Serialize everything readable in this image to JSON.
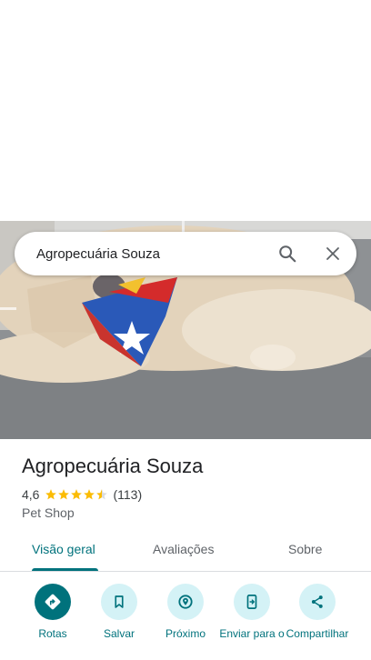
{
  "search": {
    "query": "Agropecuária Souza"
  },
  "place": {
    "name": "Agropecuária Souza",
    "rating": "4,6",
    "stars": 4.5,
    "review_count": "(113)",
    "category": "Pet Shop"
  },
  "tabs": [
    {
      "label": "Visão geral",
      "active": true
    },
    {
      "label": "Avaliações",
      "active": false
    },
    {
      "label": "Sobre",
      "active": false
    }
  ],
  "actions": [
    {
      "label": "Rotas",
      "icon": "directions-icon"
    },
    {
      "label": "Salvar",
      "icon": "bookmark-icon"
    },
    {
      "label": "Próximo",
      "icon": "nearby-icon"
    },
    {
      "label": "Enviar para o",
      "icon": "send-to-phone-icon"
    },
    {
      "label": "Compartilhar",
      "icon": "share-icon"
    }
  ],
  "colors": {
    "accent": "#00727c",
    "action_bg": "#d4f2f6",
    "star": "#fbbc04"
  }
}
